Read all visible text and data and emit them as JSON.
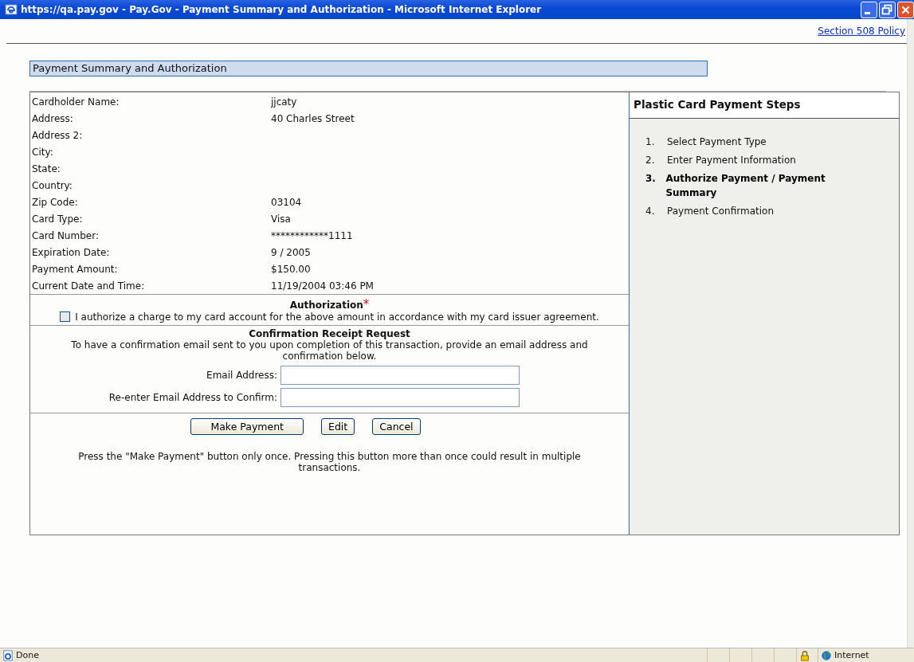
{
  "window": {
    "title": "https://qa.pay.gov - Pay.Gov - Payment Summary and Authorization - Microsoft Internet Explorer"
  },
  "top_link": "Section 508 Policy",
  "page_heading": "Payment Summary and Authorization",
  "summary": [
    {
      "label": "Cardholder Name:",
      "value": "jjcaty"
    },
    {
      "label": "Address:",
      "value": "40 Charles Street"
    },
    {
      "label": "Address 2:"
    },
    {
      "label": "City:"
    },
    {
      "label": "State:"
    },
    {
      "label": "Country:"
    },
    {
      "label": "Zip Code:",
      "value": "03104"
    },
    {
      "label": "Card Type:",
      "value": "Visa"
    },
    {
      "label": "Card Number:",
      "value": "************1111"
    },
    {
      "label": "Expiration Date:",
      "value": "9 / 2005"
    },
    {
      "label": "Payment Amount:",
      "value": "$150.00"
    },
    {
      "label": "Current Date and Time:",
      "value": "11/19/2004 03:46 PM"
    }
  ],
  "authorization": {
    "heading": "Authorization",
    "required_mark": "*",
    "checkbox": {
      "label": "I authorize a charge to my card account for the above amount in accordance with my card issuer agreement.",
      "checked": false
    }
  },
  "receipt": {
    "heading": "Confirmation Receipt Request",
    "text": "To have a confirmation email sent to you upon completion of this transaction, provide an email address and confirmation below.",
    "fields": [
      {
        "label": "Email Address:"
      },
      {
        "label": "Re-enter Email Address to Confirm:"
      }
    ]
  },
  "buttons": [
    "Make Payment",
    "Edit",
    "Cancel"
  ],
  "warning": "Press the \"Make Payment\" button only once. Pressing this button more than once could result in multiple transactions.",
  "steps": {
    "title": "Plastic Card Payment Steps",
    "items": [
      {
        "number": "1.",
        "label": "Select Payment Type",
        "selected": false
      },
      {
        "number": "2.",
        "label": "Enter Payment Information",
        "selected": false
      },
      {
        "number": "3.",
        "label": "Authorize Payment / Payment Summary",
        "selected": true
      },
      {
        "number": "4.",
        "label": "Payment Confirmation",
        "selected": false
      }
    ]
  },
  "status_bar": {
    "text": "Done",
    "zone": "Internet"
  }
}
